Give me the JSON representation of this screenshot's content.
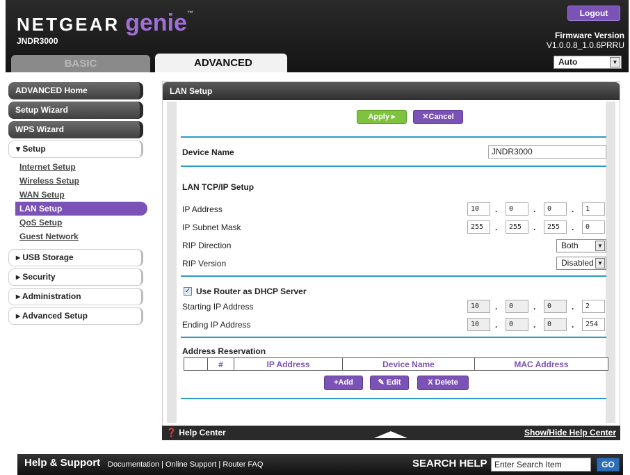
{
  "header": {
    "logo_text": "NETGEAR",
    "logo_genie": "genie",
    "logo_tm": "™",
    "model": "JNDR3000",
    "logout_label": "Logout",
    "firmware_label": "Firmware Version",
    "firmware_value": "V1.0.0.8_1.0.6PRRU",
    "tab_basic": "BASIC",
    "tab_advanced": "ADVANCED",
    "language_select": "Auto"
  },
  "sidebar": {
    "top_items": [
      {
        "label": "ADVANCED Home"
      },
      {
        "label": "Setup Wizard"
      },
      {
        "label": "WPS Wizard"
      }
    ],
    "setup_section": "▾ Setup",
    "setup_subitems": [
      {
        "label": "Internet Setup"
      },
      {
        "label": "Wireless Setup"
      },
      {
        "label": "WAN Setup"
      },
      {
        "label": "LAN Setup"
      },
      {
        "label": "QoS Setup"
      },
      {
        "label": "Guest Network"
      }
    ],
    "other_sections": [
      {
        "label": "▸ USB Storage"
      },
      {
        "label": "▸ Security"
      },
      {
        "label": "▸ Administration"
      },
      {
        "label": "▸ Advanced Setup"
      }
    ]
  },
  "main": {
    "title": "LAN Setup",
    "apply_label": "Apply ▸",
    "cancel_label": "✕Cancel",
    "device_name_label": "Device Name",
    "device_name_value": "JNDR3000",
    "lan_tcpip_title": "LAN TCP/IP Setup",
    "ip_address_label": "IP Address",
    "ip_address": [
      "10",
      "0",
      "0",
      "1"
    ],
    "subnet_label": "IP Subnet Mask",
    "subnet": [
      "255",
      "255",
      "255",
      "0"
    ],
    "rip_direction_label": "RIP Direction",
    "rip_direction_value": "Both",
    "rip_version_label": "RIP Version",
    "rip_version_value": "Disabled",
    "dhcp_checkbox_label": "Use Router as DHCP Server",
    "dhcp_checked": true,
    "start_ip_label": "Starting IP Address",
    "start_ip": [
      "10",
      "0",
      "0",
      "2"
    ],
    "end_ip_label": "Ending IP Address",
    "end_ip": [
      "10",
      "0",
      "0",
      "254"
    ],
    "reservation_title": "Address Reservation",
    "reservation_columns": [
      "",
      "#",
      "IP Address",
      "Device Name",
      "MAC Address"
    ],
    "add_label": "+Add",
    "edit_label": "Edit",
    "delete_label": "X Delete"
  },
  "helpbar": {
    "help_center": "Help Center",
    "toggle": "Show/Hide Help Center"
  },
  "footer": {
    "title": "Help & Support",
    "links": [
      "Documentation",
      "Online Support",
      "Router FAQ"
    ],
    "search_label": "SEARCH HELP",
    "search_placeholder": "Enter Search Item",
    "go_label": "GO"
  },
  "colors": {
    "accent_purple": "#7b52b5",
    "apply_green": "#7ec23e",
    "separator_blue": "#2a9bc8"
  }
}
